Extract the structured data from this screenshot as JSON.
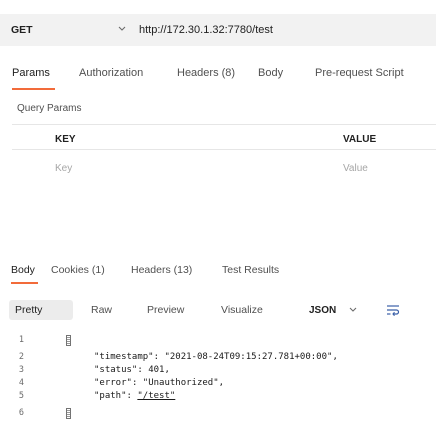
{
  "request": {
    "method": "GET",
    "url": "http://172.30.1.32:7780/test"
  },
  "request_tabs": [
    {
      "label": "Params",
      "active": true
    },
    {
      "label": "Authorization",
      "active": false
    },
    {
      "label": "Headers (8)",
      "active": false
    },
    {
      "label": "Body",
      "active": false
    },
    {
      "label": "Pre-request Script",
      "active": false
    }
  ],
  "params": {
    "section_title": "Query Params",
    "key_header": "KEY",
    "value_header": "VALUE",
    "key_placeholder": "Key",
    "value_placeholder": "Value"
  },
  "response_tabs": [
    {
      "label": "Body",
      "active": true
    },
    {
      "label": "Cookies (1)",
      "active": false
    },
    {
      "label": "Headers (13)",
      "active": false
    },
    {
      "label": "Test Results",
      "active": false
    }
  ],
  "format_tabs": [
    {
      "label": "Pretty",
      "active": true
    },
    {
      "label": "Raw",
      "active": false
    },
    {
      "label": "Preview",
      "active": false
    },
    {
      "label": "Visualize",
      "active": false
    }
  ],
  "format_select": "JSON",
  "icons": {
    "method_dropdown": "chevron-down-icon",
    "format_dropdown": "chevron-down-icon",
    "wrap": "wrap-lines-icon"
  },
  "colors": {
    "accent": "#f26b3a",
    "bar_bg": "#f2f2f2"
  },
  "response_body": {
    "line_numbers": [
      "1",
      "2",
      "3",
      "4",
      "5",
      "6"
    ],
    "timestamp_key": "\"timestamp\"",
    "timestamp_value": "\"2021-08-24T09:15:27.781+00:00\"",
    "status_key": "\"status\"",
    "status_value": "401",
    "error_key": "\"error\"",
    "error_value": "\"Unauthorized\"",
    "path_key": "\"path\"",
    "path_value": "\"/test\""
  }
}
